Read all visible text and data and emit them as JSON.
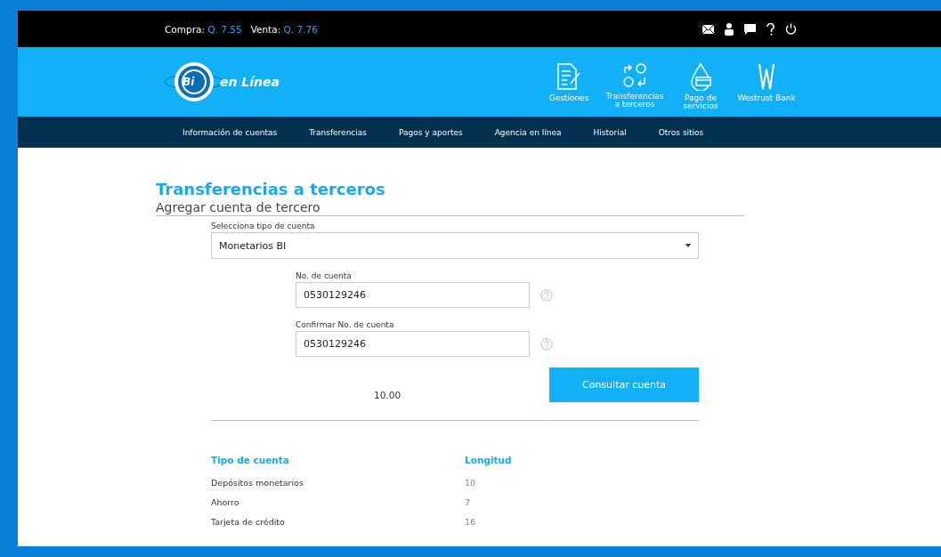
{
  "top_bar": {
    "rates": [
      {
        "label": "Compra:",
        "value": "Q. 7.55"
      },
      {
        "label": "Venta:",
        "value": "Q. 7.76"
      }
    ],
    "icons": [
      {
        "kind": "mail"
      },
      {
        "kind": "user"
      },
      {
        "kind": "chat"
      },
      {
        "kind": "help"
      },
      {
        "kind": "power"
      }
    ]
  },
  "header": {
    "logo": {
      "badge": "Bi",
      "text": "en Línea"
    },
    "quick_links": [
      {
        "kind": "document",
        "label": "Gestiones"
      },
      {
        "kind": "transfer",
        "label": "Transferencias a terceros"
      },
      {
        "kind": "payment",
        "label": "Pago de servicios"
      },
      {
        "kind": "bank",
        "label": "Westrust Bank"
      }
    ]
  },
  "nav": [
    "Información de cuentas",
    "Transferencias",
    "Pagos y aportes",
    "Agencia en línea",
    "Historial",
    "Otros sitios"
  ],
  "page": {
    "title": "Transferencias a terceros",
    "subtitle": "Agregar cuenta de tercero",
    "account_type": {
      "label": "Selecciona tipo de cuenta",
      "value": "Monetarios BI"
    },
    "fields": [
      {
        "label": "No. de cuenta",
        "value": "0530129246"
      },
      {
        "label": "Confirmar No. de cuenta",
        "value": "0530129246"
      }
    ],
    "amount": "10.00",
    "button": "Consultar cuenta",
    "table": {
      "columns": [
        "Tipo de cuenta",
        "Longitud"
      ],
      "rows": [
        [
          "Depósitos monetarios",
          "10"
        ],
        [
          "Ahorro",
          "7"
        ],
        [
          "Tarjeta de crédito",
          "16"
        ]
      ]
    }
  }
}
